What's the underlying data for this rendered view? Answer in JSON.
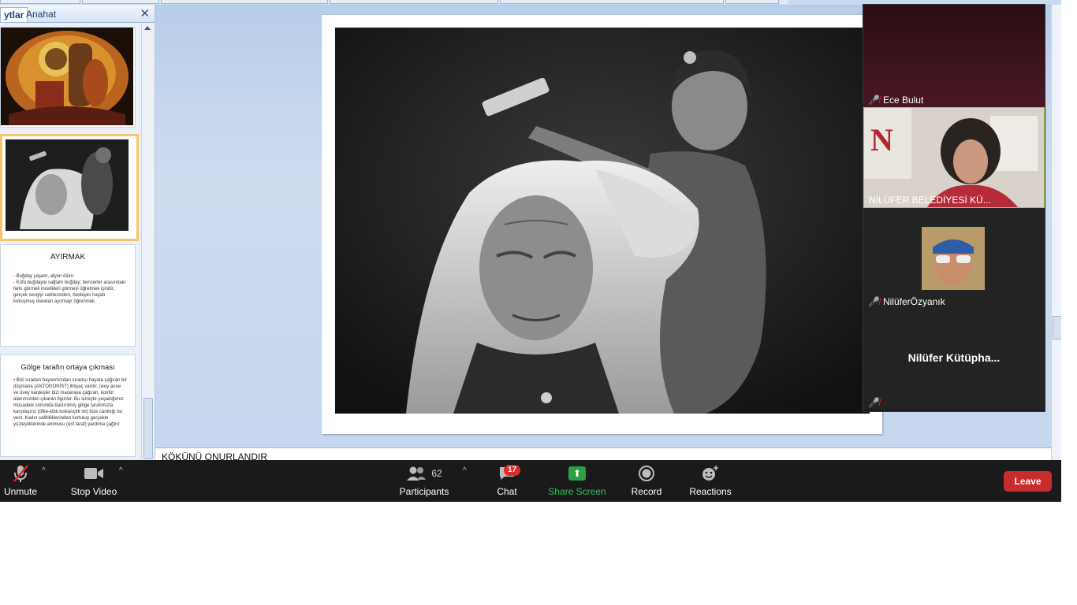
{
  "powerpoint": {
    "tabs": {
      "slides": "ytlar",
      "outline": "Anahat"
    },
    "slides": [
      {
        "title": "",
        "type": "image-dreamcatcher"
      },
      {
        "title": "",
        "type": "image-grandmother"
      },
      {
        "title": "AYIRMAK",
        "bullets": [
          "- Buğday yaşam, afyon ölüm",
          "- Küfü buğdayla sağlam buğday; benzerler arasındaki farkı görmek incelikleri görmeyi öğretmek içindir, gerçek sevgiyi sahtesinden, besleyici hayatı kokuşmuş olandan ayırmayı öğrenmek."
        ]
      },
      {
        "title": "Gölge tarafın ortaya çıkması",
        "bullets": [
          "• Bizi sıradan hayatımızdan sıradışı hayata çağıran bir düşmana (ANTOGONİST) ihtiyaç vardır, üvey anne ve üvey kardeşler bizi maceraya çağıran, konfor alanımızdan çıkaran figürler. Bu süreçte yaşadığımız mücadele sonunda bastırılmış gölge tarafımızla karşılaşırız (öfke-kibir,kıskançlık vb) bize canlılığı bu verir. Kadın safdilliklerinden kurtulup gerçekle yüzleştiklerinde animusu (eril taraf) yardıma çağırır"
        ]
      }
    ],
    "notes_text": "KÖKÜNÜ ONURLANDIR"
  },
  "meeting": {
    "participants": [
      {
        "name": "Ece Bulut",
        "muted": true
      },
      {
        "name": "NİLÜFER BELEDİYESİ KÜ...",
        "muted": false,
        "active": true
      },
      {
        "name": "NilüferÖzyanık",
        "muted": true
      },
      {
        "name": "Nilüfer  Kütüpha...",
        "muted": true
      }
    ],
    "toolbar": {
      "unmute": "Unmute",
      "stop_video": "Stop Video",
      "participants": "Participants",
      "participants_count": "62",
      "chat": "Chat",
      "chat_badge": "17",
      "share_screen": "Share Screen",
      "record": "Record",
      "reactions": "Reactions",
      "leave": "Leave"
    },
    "colors": {
      "accent_green": "#2aa043",
      "leave_red": "#c82c2c",
      "active_border": "#a5c94a"
    }
  }
}
